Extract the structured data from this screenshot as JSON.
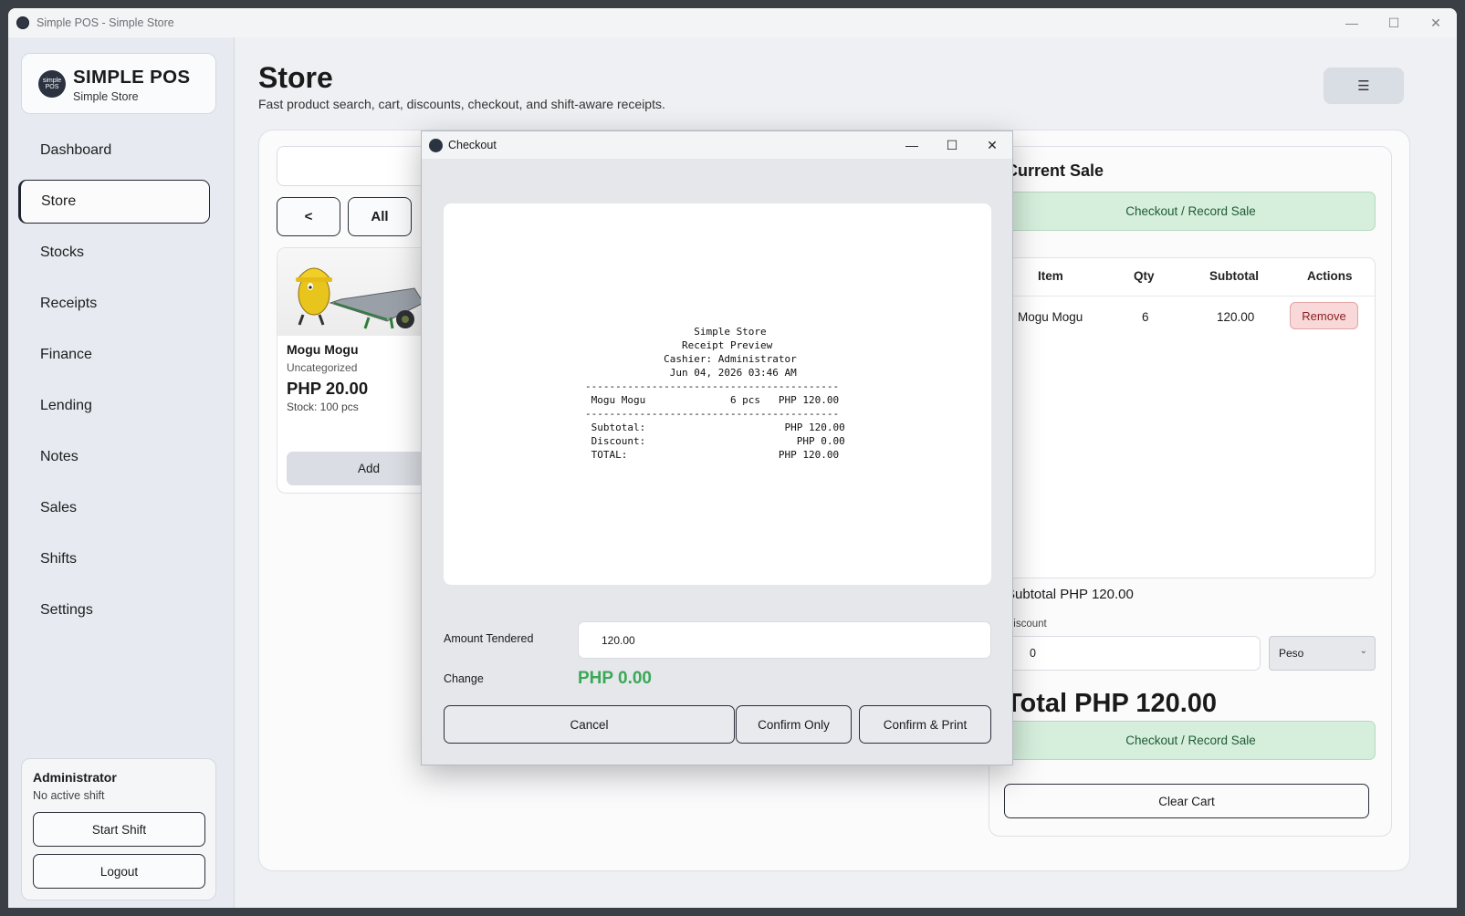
{
  "window": {
    "title": "Simple POS - Simple Store",
    "controls": {
      "minimize": "—",
      "maximize": "☐",
      "close": "✕"
    }
  },
  "brand": {
    "logo_text": "simple POS",
    "name": "SIMPLE POS",
    "store": "Simple Store"
  },
  "nav": {
    "items": [
      {
        "label": "Dashboard"
      },
      {
        "label": "Store",
        "active": true
      },
      {
        "label": "Stocks"
      },
      {
        "label": "Receipts"
      },
      {
        "label": "Finance"
      },
      {
        "label": "Lending"
      },
      {
        "label": "Notes"
      },
      {
        "label": "Sales"
      },
      {
        "label": "Shifts"
      },
      {
        "label": "Settings"
      }
    ]
  },
  "user": {
    "name": "Administrator",
    "status": "No active shift",
    "start_shift": "Start Shift",
    "logout": "Logout"
  },
  "page": {
    "title": "Store",
    "subtitle": "Fast product search, cart, discounts, checkout, and shift-aware receipts.",
    "menu_icon": "☰"
  },
  "catalog": {
    "back_label": "<",
    "all_label": "All",
    "products": [
      {
        "name": "Mogu Mogu",
        "category": "Uncategorized",
        "price": "PHP 20.00",
        "stock": "Stock: 100 pcs",
        "add_label": "Add"
      }
    ]
  },
  "sale": {
    "title": "Current Sale",
    "checkout_label": "Checkout / Record Sale",
    "columns": [
      "Item",
      "Qty",
      "Subtotal",
      "Actions"
    ],
    "rows": [
      {
        "item": "Mogu Mogu",
        "qty": "6",
        "subtotal": "120.00",
        "action": "Remove"
      }
    ],
    "subtotal": "Subtotal PHP 120.00",
    "discount_label": "Discount",
    "discount_value": "0",
    "discount_type": "Peso",
    "total": "Total PHP 120.00",
    "clear_label": "Clear Cart"
  },
  "checkout": {
    "title": "Checkout",
    "receipt_lines": [
      "                  Simple Store",
      "                Receipt Preview",
      "             Cashier: Administrator",
      "              Jun 04, 2026 03:46 AM",
      "------------------------------------------",
      " Mogu Mogu              6 pcs   PHP 120.00",
      "------------------------------------------",
      " Subtotal:                       PHP 120.00",
      " Discount:                         PHP 0.00",
      " TOTAL:                         PHP 120.00"
    ],
    "amount_label": "Amount Tendered",
    "amount_value": "120.00",
    "change_label": "Change",
    "change_value": "PHP 0.00",
    "cancel_label": "Cancel",
    "confirm_only_label": "Confirm Only",
    "confirm_print_label": "Confirm & Print"
  },
  "colors": {
    "accent_green": "#3aa857",
    "checkout_bg": "#d6efdd",
    "remove_bg": "#f8d8d8",
    "dark": "#1f2430"
  }
}
